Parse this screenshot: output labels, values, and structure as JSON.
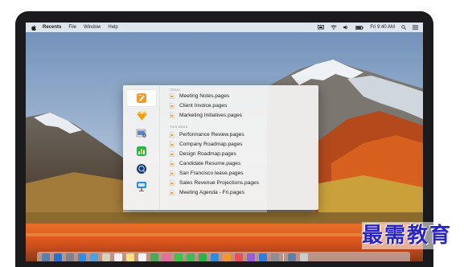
{
  "menubar": {
    "app_name": "Recents",
    "items": [
      "File",
      "Window",
      "Help"
    ],
    "clock": "Fri 9:40 AM"
  },
  "recents": {
    "apps": [
      {
        "name": "Pages",
        "icon": "pages-icon",
        "selected": true
      },
      {
        "name": "Sketch",
        "icon": "sketch-icon",
        "selected": false
      },
      {
        "name": "Preview",
        "icon": "preview-icon",
        "selected": false
      },
      {
        "name": "Numbers",
        "icon": "numbers-icon",
        "selected": false
      },
      {
        "name": "QuickTime Player",
        "icon": "quicktime-icon",
        "selected": false
      },
      {
        "name": "Keynote",
        "icon": "keynote-icon",
        "selected": false
      }
    ],
    "section_today": "TODAY",
    "section_week": "THIS WEEK",
    "today_files": [
      "Meeting Notes.pages",
      "Client Invoice.pages",
      "Marketing Initiatives.pages"
    ],
    "week_files": [
      "Performance Review.pages",
      "Company Roadmap.pages",
      "Design Roadmap.pages",
      "Candidate Resume.pages",
      "San Francisco lease.pages",
      "Sales Revenue Projections.pages",
      "Meeting Agenda - Fri.pages"
    ]
  },
  "watermark": "最需教育",
  "colors": {
    "bezel": "#1b1b1d",
    "watermark": "#2a24c8",
    "sunset": "#e8702a"
  }
}
